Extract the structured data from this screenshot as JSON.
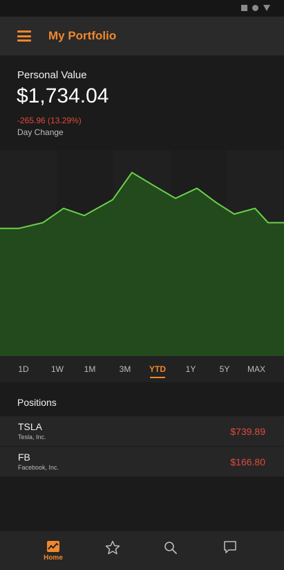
{
  "app": {
    "title": "My Portfolio"
  },
  "summary": {
    "label": "Personal Value",
    "value": "$1,734.04",
    "change": "-265.96 (13.29%)",
    "change_label": "Day Change"
  },
  "chart_data": {
    "type": "area",
    "values": [
      0.6,
      0.6,
      0.64,
      0.74,
      0.69,
      0.8,
      0.99,
      0.9,
      0.81,
      0.88,
      0.78,
      0.7,
      0.74,
      0.64,
      0.64
    ],
    "line_color": "#6ad14a",
    "fill_color": "#234a1d",
    "ylim": [
      0,
      1
    ],
    "grid": false
  },
  "ranges": {
    "items": [
      "1D",
      "1W",
      "1M",
      "3M",
      "YTD",
      "1Y",
      "5Y",
      "MAX"
    ],
    "selected": "YTD"
  },
  "positions": {
    "header": "Positions",
    "items": [
      {
        "symbol": "TSLA",
        "name": "Tesla, Inc.",
        "price": "$739.89"
      },
      {
        "symbol": "FB",
        "name": "Facebook, Inc.",
        "price": "$166.80"
      }
    ]
  },
  "nav": {
    "items": [
      {
        "icon": "chart-icon",
        "label": "Home",
        "active": true
      },
      {
        "icon": "star-icon",
        "label": "",
        "active": false
      },
      {
        "icon": "search-icon",
        "label": "",
        "active": false
      },
      {
        "icon": "chat-icon",
        "label": "",
        "active": false
      }
    ]
  },
  "colors": {
    "accent": "#f0882d",
    "negative": "#e04a3c",
    "positive_line": "#6ad14a"
  }
}
